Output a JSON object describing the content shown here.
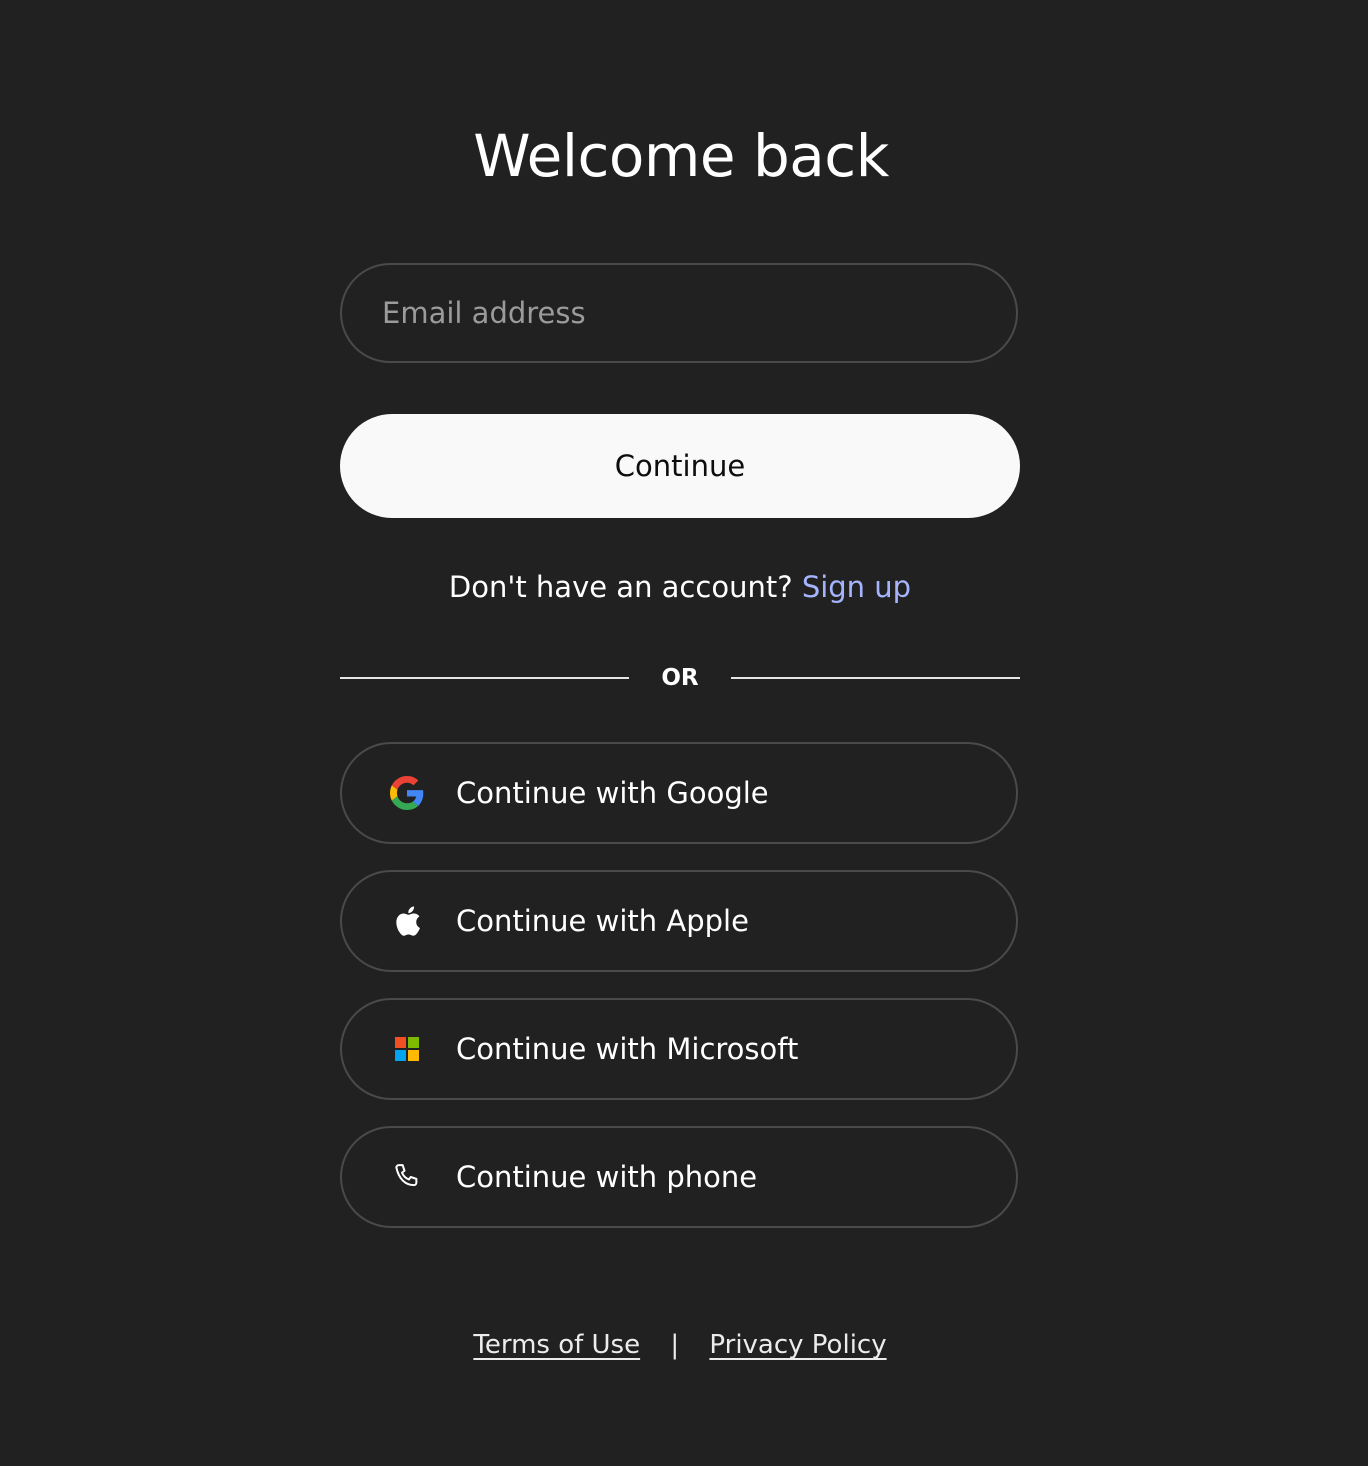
{
  "title": "Welcome back",
  "email": {
    "placeholder": "Email address",
    "value": ""
  },
  "continue_label": "Continue",
  "signup": {
    "prompt": "Don't have an account?",
    "link": "Sign up"
  },
  "divider_label": "OR",
  "social": [
    {
      "label": "Continue with Google",
      "icon": "google-icon"
    },
    {
      "label": "Continue with Apple",
      "icon": "apple-icon"
    },
    {
      "label": "Continue with Microsoft",
      "icon": "microsoft-icon"
    },
    {
      "label": "Continue with phone",
      "icon": "phone-icon"
    }
  ],
  "footer": {
    "terms": "Terms of Use",
    "separator": "|",
    "privacy": "Privacy Policy"
  },
  "colors": {
    "background": "#212121",
    "button_primary": "#f9f9f9",
    "link_accent": "#a5b4fc",
    "border": "#4a4a4a"
  }
}
